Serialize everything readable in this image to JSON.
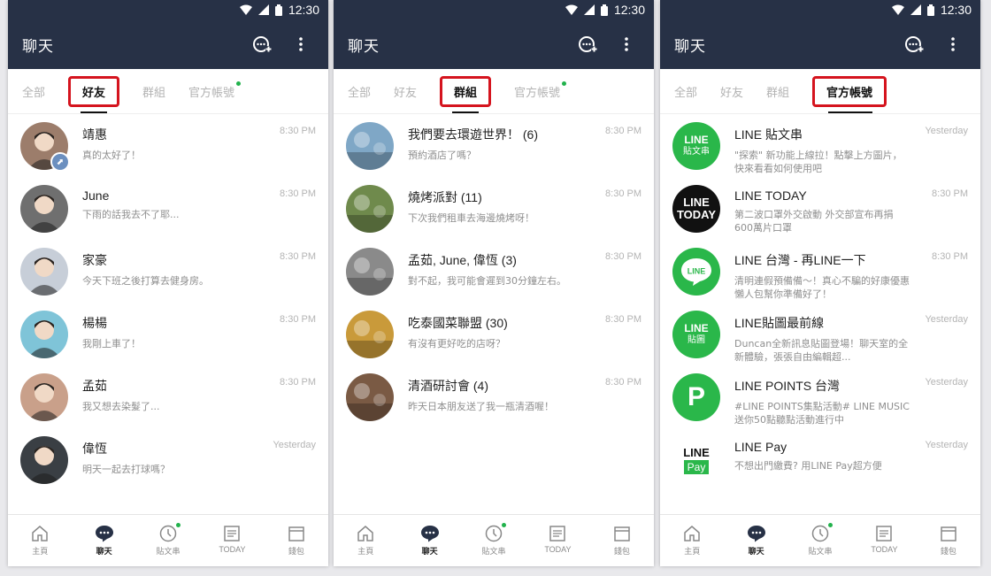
{
  "status_time": "12:30",
  "app_title": "聊天",
  "phones": [
    {
      "tabs": [
        {
          "label": "全部",
          "active": false,
          "dot": false
        },
        {
          "label": "好友",
          "active": true,
          "dot": false
        },
        {
          "label": "群組",
          "active": false,
          "dot": false
        },
        {
          "label": "官方帳號",
          "active": false,
          "dot": true
        }
      ],
      "chats": [
        {
          "name": "靖惠",
          "msg": "真的太好了！",
          "time": "8:30 PM",
          "avatar": "person-photo",
          "color": "#9c7d6b",
          "badge": true
        },
        {
          "name": "June",
          "msg": "下雨的話我去不了耶...",
          "time": "8:30 PM",
          "avatar": "person-photo",
          "color": "#6f6f6f"
        },
        {
          "name": "家豪",
          "msg": "今天下班之後打算去健身房。",
          "time": "8:30 PM",
          "avatar": "person-photo",
          "color": "#c7ced8"
        },
        {
          "name": "楊楊",
          "msg": "我剛上車了！",
          "time": "8:30 PM",
          "avatar": "person-photo",
          "color": "#7fc4d8"
        },
        {
          "name": "孟茹",
          "msg": "我又想去染髮了...",
          "time": "8:30 PM",
          "avatar": "person-photo",
          "color": "#c9a08a"
        },
        {
          "name": "偉恆",
          "msg": "明天一起去打球嗎？",
          "time": "Yesterday",
          "avatar": "person-photo",
          "color": "#3a3f44"
        }
      ]
    },
    {
      "tabs": [
        {
          "label": "全部",
          "active": false,
          "dot": false
        },
        {
          "label": "好友",
          "active": false,
          "dot": false
        },
        {
          "label": "群組",
          "active": true,
          "dot": false
        },
        {
          "label": "官方帳號",
          "active": false,
          "dot": true
        }
      ],
      "chats": [
        {
          "name": "我們要去環遊世界！ (6)",
          "msg": "預約酒店了嗎？",
          "time": "8:30 PM",
          "avatar": "group-photo",
          "color": "#7fa7c6"
        },
        {
          "name": "燒烤派對 (11)",
          "msg": "下次我們租車去海邊燒烤呀！",
          "time": "8:30 PM",
          "avatar": "group-photo",
          "color": "#6f8a4c"
        },
        {
          "name": "孟茹, June, 偉恆 (3)",
          "msg": "對不起，我可能會遲到30分鐘左右。",
          "time": "8:30 PM",
          "avatar": "group-photo",
          "color": "#8a8a8a"
        },
        {
          "name": "吃泰國菜聯盟 (30)",
          "msg": "有沒有更好吃的店呀？",
          "time": "8:30 PM",
          "avatar": "group-photo",
          "color": "#c99a3a"
        },
        {
          "name": "清酒研討會 (4)",
          "msg": "昨天日本朋友送了我一瓶清酒喔！",
          "time": "8:30 PM",
          "avatar": "group-photo",
          "color": "#7a5a44"
        }
      ]
    },
    {
      "tabs": [
        {
          "label": "全部",
          "active": false,
          "dot": false
        },
        {
          "label": "好友",
          "active": false,
          "dot": false
        },
        {
          "label": "群組",
          "active": false,
          "dot": false
        },
        {
          "label": "官方帳號",
          "active": true,
          "dot": false
        }
      ],
      "chats": [
        {
          "name": "LINE 貼文串",
          "msg": "\"探索\" 新功能上線拉！點擊上方圖片，快來看看如何使用吧",
          "time": "Yesterday",
          "logo": "line",
          "logo_l1": "LINE",
          "logo_l2": "貼文串"
        },
        {
          "name": "LINE TODAY",
          "msg": "第二波口罩外交啟動 外交部宣布再捐600萬片口罩",
          "time": "8:30 PM",
          "logo": "today",
          "logo_l1": "LINE",
          "logo_l2": "TODAY"
        },
        {
          "name": "LINE 台灣 - 再LINE一下",
          "msg": "清明連假預備備～！真心不騙的好康優惠懶人包幫你準備好了！",
          "time": "8:30 PM",
          "logo": "bubble",
          "logo_l1": "LINE"
        },
        {
          "name": "LINE貼圖最前線",
          "msg": "Duncan全新訊息貼圖登場！聊天室的全新體驗，張張自由編輯超...",
          "time": "Yesterday",
          "logo": "line",
          "logo_l1": "LINE",
          "logo_l2": "貼圖"
        },
        {
          "name": "LINE POINTS 台灣",
          "msg": "#LINE POINTS集點活動# LINE MUSIC送你50點聽點活動進行中",
          "time": "Yesterday",
          "logo": "points",
          "logo_l1": "P"
        },
        {
          "name": "LINE Pay",
          "msg": "不想出門繳費? 用LINE Pay超方便",
          "time": "Yesterday",
          "logo": "pay",
          "logo_l1": "LINE",
          "logo_l2": "Pay"
        }
      ]
    }
  ],
  "nav": [
    {
      "label": "主頁",
      "icon": "home-icon",
      "active": false,
      "dot": false
    },
    {
      "label": "聊天",
      "icon": "chat-icon",
      "active": true,
      "dot": false
    },
    {
      "label": "貼文串",
      "icon": "clock-icon",
      "active": false,
      "dot": true
    },
    {
      "label": "TODAY",
      "icon": "news-icon",
      "active": false,
      "dot": false
    },
    {
      "label": "錢包",
      "icon": "wallet-icon",
      "active": false,
      "dot": false
    }
  ],
  "colors": {
    "header": "#273146",
    "highlight": "#d5141e",
    "line_green": "#2ab74a"
  }
}
